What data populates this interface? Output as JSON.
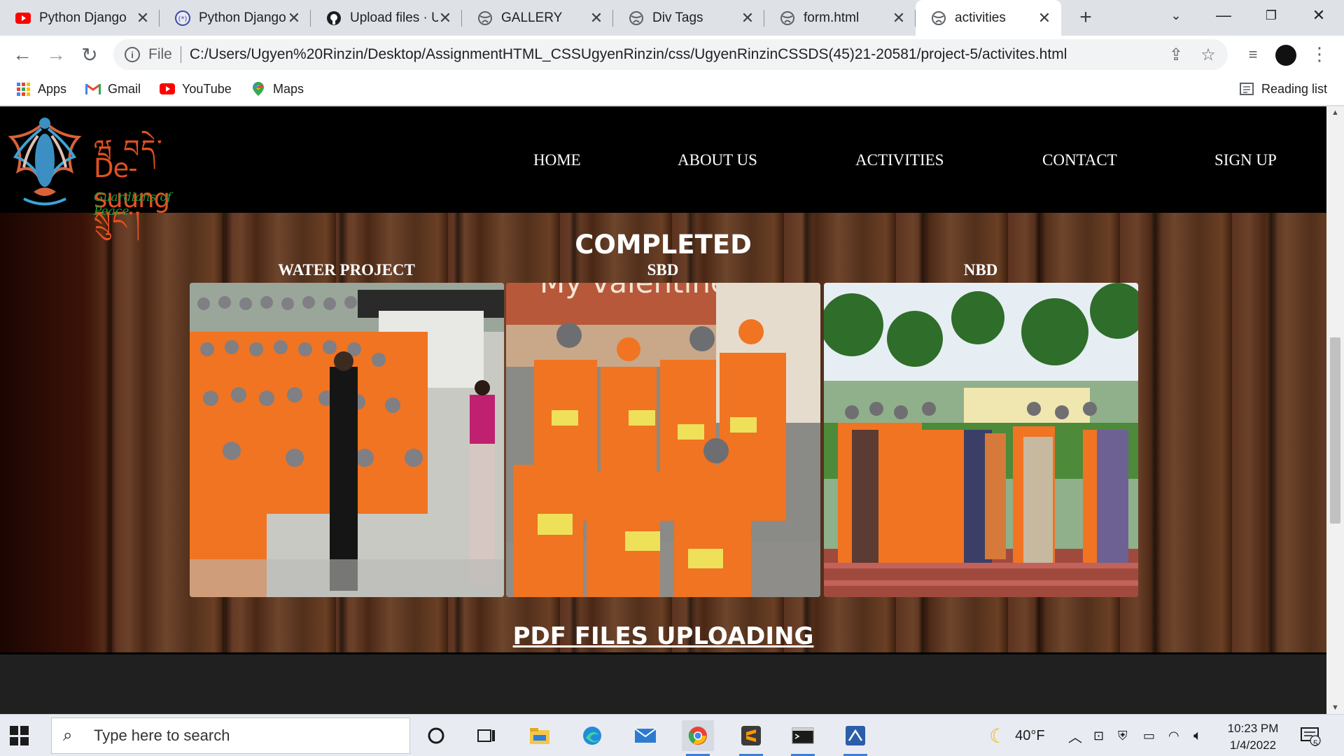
{
  "browser": {
    "tabs": [
      {
        "title": "Python Django",
        "icon": "youtube-icon"
      },
      {
        "title": "Python Django",
        "icon": "django-icon"
      },
      {
        "title": "Upload files · U",
        "icon": "github-icon"
      },
      {
        "title": "GALLERY",
        "icon": "globe-icon"
      },
      {
        "title": "Div Tags",
        "icon": "globe-icon"
      },
      {
        "title": "form.html",
        "icon": "globe-icon"
      },
      {
        "title": "activities",
        "icon": "globe-icon",
        "active": true
      }
    ],
    "address": {
      "scheme_label": "File",
      "url": "C:/Users/Ugyen%20Rinzin/Desktop/AssignmentHTML_CSSUgyenRinzin/css/UgyenRinzinCSSDS(45)21-20581/project-5/activites.html"
    },
    "bookmarks": [
      {
        "label": "Apps",
        "icon": "apps-grid-icon"
      },
      {
        "label": "Gmail",
        "icon": "gmail-icon"
      },
      {
        "label": "YouTube",
        "icon": "youtube-icon"
      },
      {
        "label": "Maps",
        "icon": "maps-pin-icon"
      }
    ],
    "reading_list": "Reading list"
  },
  "site": {
    "brand": {
      "script": "ཝ བདེ་སྲུང་།",
      "name": "De-suung",
      "tagline": "Guardians of Peace"
    },
    "nav": [
      "HOME",
      "ABOUT US",
      "ACTIVITIES",
      "CONTACT",
      "SIGN UP"
    ],
    "section_title": "COMPLETED",
    "projects": [
      {
        "label": "WATER PROJECT"
      },
      {
        "label": "SBD"
      },
      {
        "label": "NBD"
      }
    ],
    "photo_caption_fragment": "My valentine gift",
    "pdf_heading": "PDF FILES UPLOADING"
  },
  "taskbar": {
    "search_placeholder": "Type here to search",
    "weather": "40°F",
    "time": "10:23 PM",
    "date": "1/4/2022",
    "notifications": "5"
  },
  "colors": {
    "header_bg": "#000000",
    "brand_orange": "#e2521e",
    "brand_green": "#1e9e3c",
    "uniform_orange": "#f07422"
  }
}
